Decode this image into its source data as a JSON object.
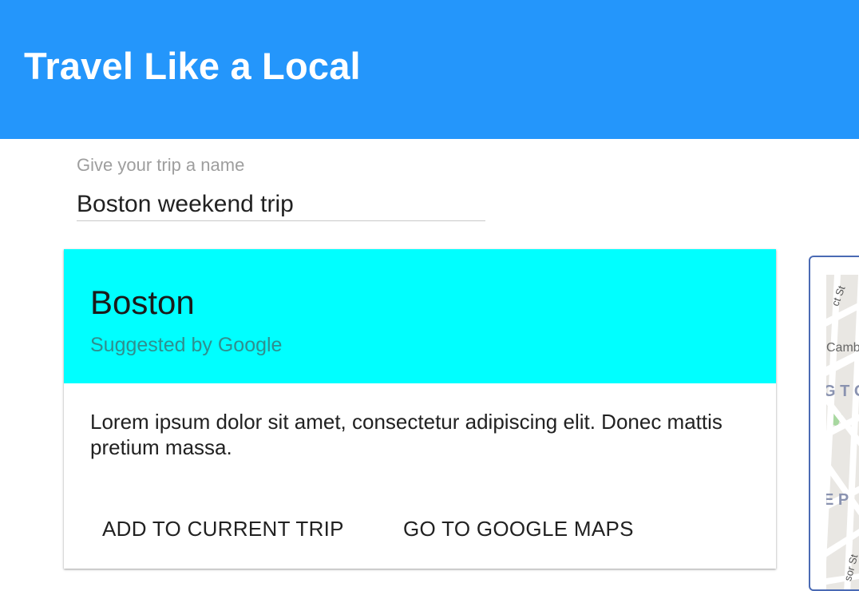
{
  "header": {
    "title": "Travel Like a Local",
    "background": "#2496fb"
  },
  "trip_name": {
    "label": "Give your trip a name",
    "value": "Boston weekend trip"
  },
  "card": {
    "title": "Boston",
    "subtitle": "Suggested by Google",
    "header_color": "#00ffff",
    "body": "Lorem ipsum dolor sit amet, consectetur adipiscing elit. Donec mattis pretium massa.",
    "actions": {
      "add_label": "ADD TO CURRENT TRIP",
      "maps_label": "GO TO GOOGLE MAPS"
    }
  },
  "map": {
    "labels": [
      "ct St",
      "Camb",
      "G T O",
      "E P",
      "sor St"
    ]
  }
}
